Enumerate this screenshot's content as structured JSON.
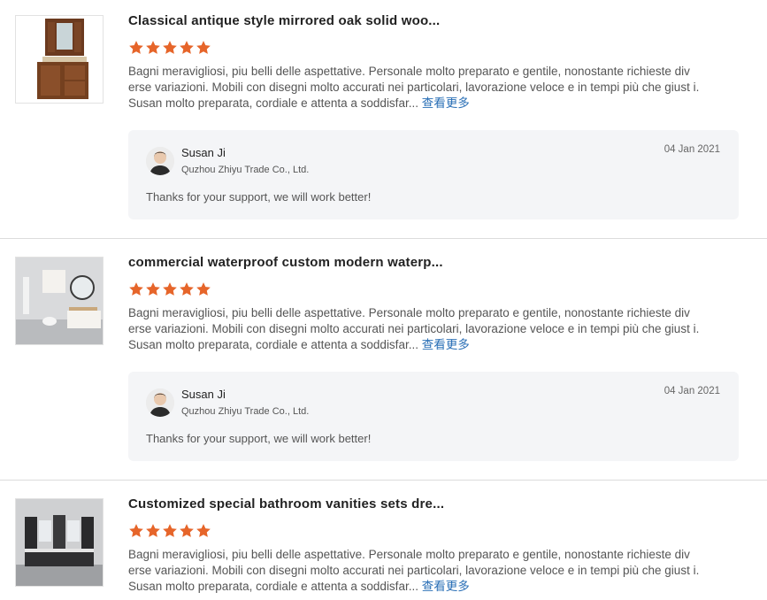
{
  "colors": {
    "star": "#e6652a",
    "link": "#2a6fb6",
    "reply_bg": "#f4f5f7"
  },
  "reviews": [
    {
      "title": "Classical antique style mirrored oak solid woo...",
      "rating": 5,
      "text": "Bagni meravigliosi, piu belli delle aspettative.  Personale molto preparato e gentile, nonostante richieste div erse variazioni.  Mobili con disegni molto accurati nei particolari, lavorazione veloce e in tempi più che giust i.  Susan molto preparata, cordiale e attenta a soddisfar...",
      "more": "查看更多",
      "reply": {
        "name": "Susan Ji",
        "company": "Quzhou Zhiyu Trade Co., Ltd.",
        "date": "04 Jan 2021",
        "text": "Thanks for your support, we will work better!"
      }
    },
    {
      "title": "commercial waterproof custom modern waterp...",
      "rating": 5,
      "text": "Bagni meravigliosi, piu belli delle aspettative.  Personale molto preparato e gentile, nonostante richieste div erse variazioni.  Mobili con disegni molto accurati nei particolari, lavorazione veloce e in tempi più che giust i.  Susan molto preparata, cordiale e attenta a soddisfar...",
      "more": "查看更多",
      "reply": {
        "name": "Susan Ji",
        "company": "Quzhou Zhiyu Trade Co., Ltd.",
        "date": "04 Jan 2021",
        "text": "Thanks for your support, we will work better!"
      }
    },
    {
      "title": "Customized special bathroom vanities sets dre...",
      "rating": 5,
      "text": "Bagni meravigliosi, piu belli delle aspettative.  Personale molto preparato e gentile, nonostante richieste div erse variazioni.  Mobili con disegni molto accurati nei particolari, lavorazione veloce e in tempi più che giust i.  Susan molto preparata, cordiale e attenta a soddisfar...",
      "more": "查看更多"
    }
  ]
}
